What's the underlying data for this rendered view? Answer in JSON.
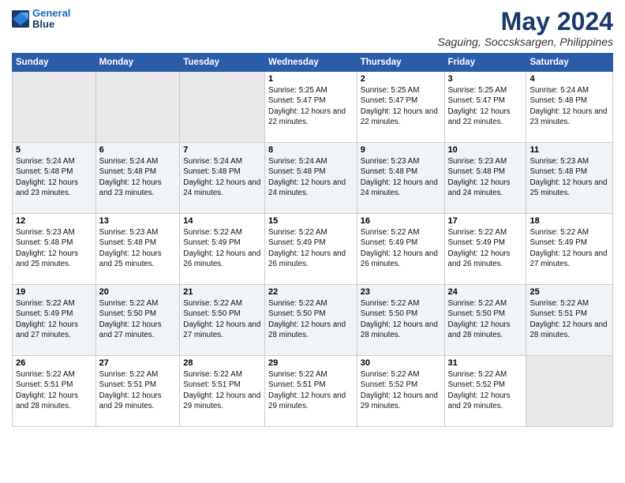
{
  "logo": {
    "line1": "General",
    "line2": "Blue"
  },
  "title": "May 2024",
  "subtitle": "Saguing, Soccsksargen, Philippines",
  "days_of_week": [
    "Sunday",
    "Monday",
    "Tuesday",
    "Wednesday",
    "Thursday",
    "Friday",
    "Saturday"
  ],
  "weeks": [
    [
      {
        "day": "",
        "empty": true
      },
      {
        "day": "",
        "empty": true
      },
      {
        "day": "",
        "empty": true
      },
      {
        "day": "1",
        "sunrise": "5:25 AM",
        "sunset": "5:47 PM",
        "daylight": "12 hours and 22 minutes."
      },
      {
        "day": "2",
        "sunrise": "5:25 AM",
        "sunset": "5:47 PM",
        "daylight": "12 hours and 22 minutes."
      },
      {
        "day": "3",
        "sunrise": "5:25 AM",
        "sunset": "5:47 PM",
        "daylight": "12 hours and 22 minutes."
      },
      {
        "day": "4",
        "sunrise": "5:24 AM",
        "sunset": "5:48 PM",
        "daylight": "12 hours and 23 minutes."
      }
    ],
    [
      {
        "day": "5",
        "sunrise": "5:24 AM",
        "sunset": "5:48 PM",
        "daylight": "12 hours and 23 minutes."
      },
      {
        "day": "6",
        "sunrise": "5:24 AM",
        "sunset": "5:48 PM",
        "daylight": "12 hours and 23 minutes."
      },
      {
        "day": "7",
        "sunrise": "5:24 AM",
        "sunset": "5:48 PM",
        "daylight": "12 hours and 24 minutes."
      },
      {
        "day": "8",
        "sunrise": "5:24 AM",
        "sunset": "5:48 PM",
        "daylight": "12 hours and 24 minutes."
      },
      {
        "day": "9",
        "sunrise": "5:23 AM",
        "sunset": "5:48 PM",
        "daylight": "12 hours and 24 minutes."
      },
      {
        "day": "10",
        "sunrise": "5:23 AM",
        "sunset": "5:48 PM",
        "daylight": "12 hours and 24 minutes."
      },
      {
        "day": "11",
        "sunrise": "5:23 AM",
        "sunset": "5:48 PM",
        "daylight": "12 hours and 25 minutes."
      }
    ],
    [
      {
        "day": "12",
        "sunrise": "5:23 AM",
        "sunset": "5:48 PM",
        "daylight": "12 hours and 25 minutes."
      },
      {
        "day": "13",
        "sunrise": "5:23 AM",
        "sunset": "5:48 PM",
        "daylight": "12 hours and 25 minutes."
      },
      {
        "day": "14",
        "sunrise": "5:22 AM",
        "sunset": "5:49 PM",
        "daylight": "12 hours and 26 minutes."
      },
      {
        "day": "15",
        "sunrise": "5:22 AM",
        "sunset": "5:49 PM",
        "daylight": "12 hours and 26 minutes."
      },
      {
        "day": "16",
        "sunrise": "5:22 AM",
        "sunset": "5:49 PM",
        "daylight": "12 hours and 26 minutes."
      },
      {
        "day": "17",
        "sunrise": "5:22 AM",
        "sunset": "5:49 PM",
        "daylight": "12 hours and 26 minutes."
      },
      {
        "day": "18",
        "sunrise": "5:22 AM",
        "sunset": "5:49 PM",
        "daylight": "12 hours and 27 minutes."
      }
    ],
    [
      {
        "day": "19",
        "sunrise": "5:22 AM",
        "sunset": "5:49 PM",
        "daylight": "12 hours and 27 minutes."
      },
      {
        "day": "20",
        "sunrise": "5:22 AM",
        "sunset": "5:50 PM",
        "daylight": "12 hours and 27 minutes."
      },
      {
        "day": "21",
        "sunrise": "5:22 AM",
        "sunset": "5:50 PM",
        "daylight": "12 hours and 27 minutes."
      },
      {
        "day": "22",
        "sunrise": "5:22 AM",
        "sunset": "5:50 PM",
        "daylight": "12 hours and 28 minutes."
      },
      {
        "day": "23",
        "sunrise": "5:22 AM",
        "sunset": "5:50 PM",
        "daylight": "12 hours and 28 minutes."
      },
      {
        "day": "24",
        "sunrise": "5:22 AM",
        "sunset": "5:50 PM",
        "daylight": "12 hours and 28 minutes."
      },
      {
        "day": "25",
        "sunrise": "5:22 AM",
        "sunset": "5:51 PM",
        "daylight": "12 hours and 28 minutes."
      }
    ],
    [
      {
        "day": "26",
        "sunrise": "5:22 AM",
        "sunset": "5:51 PM",
        "daylight": "12 hours and 28 minutes."
      },
      {
        "day": "27",
        "sunrise": "5:22 AM",
        "sunset": "5:51 PM",
        "daylight": "12 hours and 29 minutes."
      },
      {
        "day": "28",
        "sunrise": "5:22 AM",
        "sunset": "5:51 PM",
        "daylight": "12 hours and 29 minutes."
      },
      {
        "day": "29",
        "sunrise": "5:22 AM",
        "sunset": "5:51 PM",
        "daylight": "12 hours and 29 minutes."
      },
      {
        "day": "30",
        "sunrise": "5:22 AM",
        "sunset": "5:52 PM",
        "daylight": "12 hours and 29 minutes."
      },
      {
        "day": "31",
        "sunrise": "5:22 AM",
        "sunset": "5:52 PM",
        "daylight": "12 hours and 29 minutes."
      },
      {
        "day": "",
        "empty": true
      }
    ]
  ],
  "labels": {
    "sunrise": "Sunrise:",
    "sunset": "Sunset:",
    "daylight": "Daylight:"
  }
}
